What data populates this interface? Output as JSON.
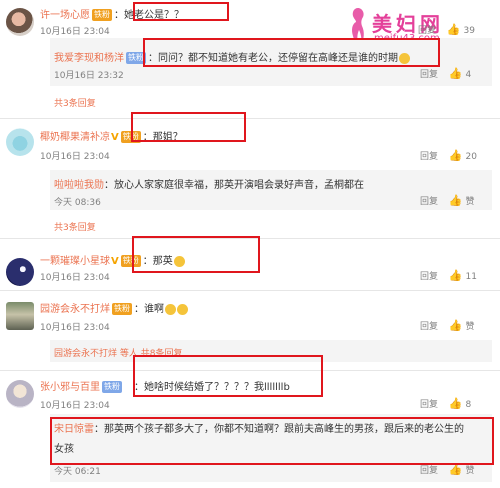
{
  "watermark": {
    "text": "美妇网",
    "url": "meifu43.com"
  },
  "comments": [
    {
      "user": "许一场心愿",
      "badge": "铁粉",
      "text": "：她老公是？？",
      "time": "10月16日 23:04",
      "reply_label": "回复",
      "likes": "39"
    },
    {
      "user": "我爱李现和杨洋",
      "badge": "铁粉",
      "text": "：同问？都不知道她有老公，还停留在高峰还是谁的时期",
      "time": "10月16日 23:32",
      "reply_label": "回复",
      "likes": "4"
    },
    {
      "more": "共3条回复"
    },
    {
      "user": "椰奶椰果清补凉",
      "badge": "铁粉",
      "text": "：那姐？",
      "time": "10月16日 23:04",
      "reply_label": "回复",
      "likes": "20"
    },
    {
      "user": "啦啦啦我勋",
      "text": "：放心人家家庭很幸福，那英开演唱会录好声音，孟桐都在",
      "time": "今天 08:36",
      "reply_label": "回复",
      "likes": "赞"
    },
    {
      "more": "共3条回复"
    },
    {
      "user": "一颗璀璨小星球",
      "badge": "铁粉",
      "text": "：那英",
      "time": "10月16日 23:04",
      "reply_label": "回复",
      "likes": "11"
    },
    {
      "user": "园游会永不打烊",
      "badge": "铁粉",
      "text": "：谁啊",
      "time": "10月16日 23:04",
      "reply_label": "回复",
      "likes": "赞"
    },
    {
      "more": "园游会永不打烊 等人 共8条回复"
    },
    {
      "user": "张小邪与百里",
      "badge": "铁粉",
      "text": "：她啥时候结婚了？？？？我lllllllb",
      "time": "10月16日 23:04",
      "reply_label": "回复",
      "likes": "8"
    },
    {
      "user": "宋日惊雷",
      "text": "：那英两个孩子都多大了，你都不知道啊？跟前夫高峰生的男孩，跟后来的老公生的女孩",
      "time": "今天 06:21",
      "reply_label": "回复",
      "likes": "赞"
    }
  ]
}
